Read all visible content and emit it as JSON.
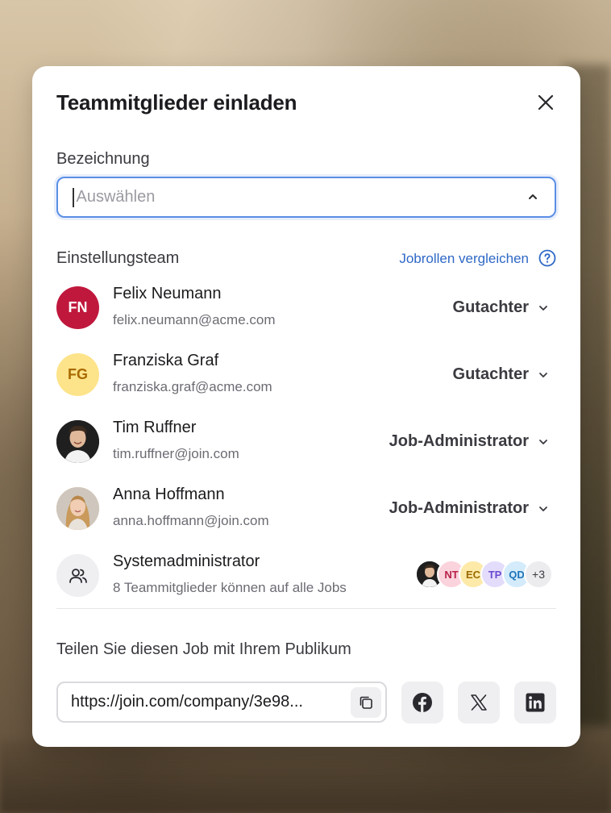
{
  "modal": {
    "title": "Teammitglieder einladen",
    "close_icon": "close-icon"
  },
  "designation": {
    "label": "Bezeichnung",
    "placeholder": "Auswählen",
    "chevron_icon": "chevron-up-icon"
  },
  "hiring_team": {
    "label": "Einstellungsteam",
    "compare_link": "Jobrollen vergleichen",
    "help_icon": "help-circle-icon",
    "accent_color": "#2f68c6",
    "members": [
      {
        "initials": "FN",
        "name": "Felix Neumann",
        "email": "felix.neumann@acme.com",
        "role": "Gutachter",
        "avatar_bg": "#c0183d",
        "avatar_fg": "#ffffff"
      },
      {
        "initials": "FG",
        "name": "Franziska Graf",
        "email": "franziska.graf@acme.com",
        "role": "Gutachter",
        "avatar_bg": "#fde38a",
        "avatar_fg": "#a86a00"
      },
      {
        "initials": "",
        "name": "Tim Ruffner",
        "email": "tim.ruffner@join.com",
        "role": "Job-Administrator",
        "avatar_bg": "#2a2a2a",
        "avatar_fg": "#ffffff"
      },
      {
        "initials": "",
        "name": "Anna Hoffmann",
        "email": "anna.hoffmann@join.com",
        "role": "Job-Administrator",
        "avatar_bg": "#d9b48a",
        "avatar_fg": "#ffffff"
      }
    ],
    "sysadmin": {
      "name": "Systemadministrator",
      "description": "8 Teammitglieder können auf alle Jobs",
      "icon": "users-icon",
      "stack": [
        {
          "text": "",
          "bg": "#222222",
          "fg": "#ffffff"
        },
        {
          "text": "NT",
          "bg": "#fbd3dc",
          "fg": "#b8214a"
        },
        {
          "text": "EC",
          "bg": "#fde9a8",
          "fg": "#9a6a00"
        },
        {
          "text": "TP",
          "bg": "#e4dcfb",
          "fg": "#6a4bd1"
        },
        {
          "text": "QD",
          "bg": "#d3ebfb",
          "fg": "#1f74b8"
        },
        {
          "text": "+3",
          "bg": "#ececef",
          "fg": "#3a3a40"
        }
      ]
    }
  },
  "share": {
    "label": "Teilen Sie diesen Job mit Ihrem Publikum",
    "url": "https://join.com/company/3e98...",
    "copy_icon": "copy-icon",
    "buttons": [
      "facebook-icon",
      "x-icon",
      "linkedin-icon"
    ]
  }
}
